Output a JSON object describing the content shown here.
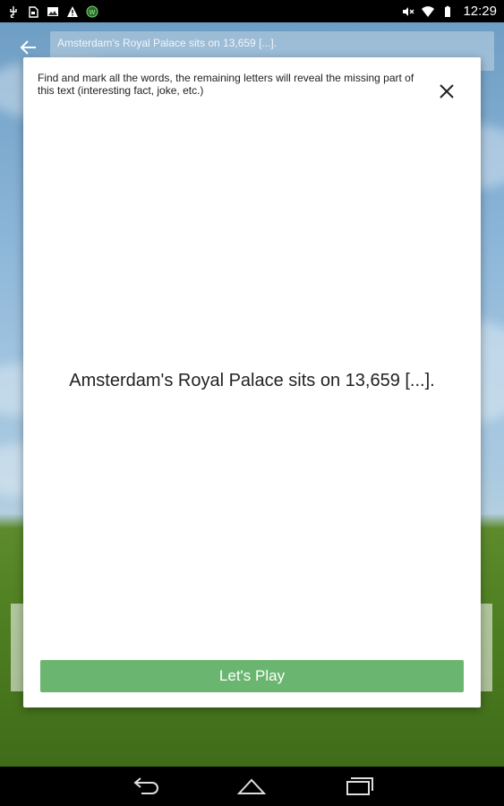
{
  "status_bar": {
    "time": "12:29",
    "left_icons": [
      "usb-icon",
      "sd-card-icon",
      "image-icon",
      "warning-icon",
      "app-notification-icon"
    ],
    "right_icons": [
      "mute-icon",
      "wifi-icon",
      "battery-icon"
    ]
  },
  "header": {
    "title": "Amsterdam's Royal Palace sits on 13,659 [...]."
  },
  "dialog": {
    "instructions": "Find and mark all the words, the remaining letters will reveal the missing part of this text (interesting fact, joke, etc.)",
    "puzzle_text": "Amsterdam's Royal Palace sits on 13,659 [...].",
    "play_button": "Let's Play"
  },
  "colors": {
    "play_button": "#6ab56f",
    "status_bar": "#000000",
    "nav_bar": "#000000",
    "dialog_bg": "#ffffff"
  }
}
